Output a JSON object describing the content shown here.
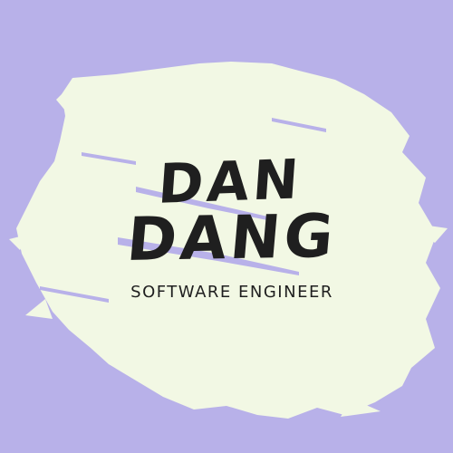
{
  "name": {
    "first_line": "DAN",
    "second_line": "DANG"
  },
  "subtitle": "SOFTWARE ENGINEER",
  "colors": {
    "background": "#b8b1e9",
    "brush": "#f2f8e4",
    "text": "#1f1f1f"
  },
  "icons": {
    "brush": "paint-brush-stroke"
  }
}
